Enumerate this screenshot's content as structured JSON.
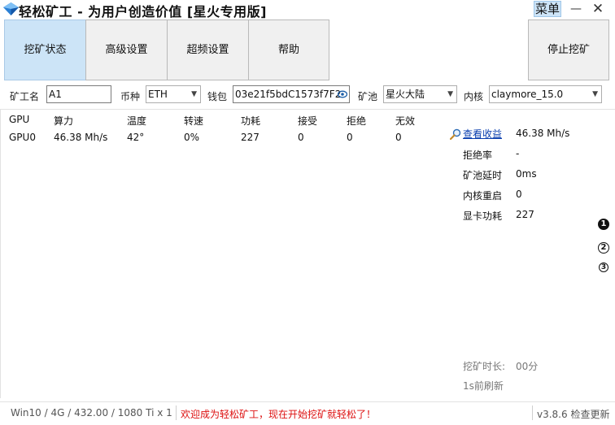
{
  "app": {
    "title": "轻松矿工 - 为用户创造价值 [星火专用版]"
  },
  "titlebar": {
    "menu_label": "菜单",
    "minimize_glyph": "—",
    "close_glyph": "✕"
  },
  "tabs": [
    {
      "label": "挖矿状态",
      "active": true
    },
    {
      "label": "高级设置",
      "active": false
    },
    {
      "label": "超频设置",
      "active": false
    },
    {
      "label": "帮助",
      "active": false
    }
  ],
  "stop_button_label": "停止挖矿",
  "config": {
    "worker_label": "矿工名",
    "worker_value": "A1",
    "coin_label": "币种",
    "coin_value": "ETH",
    "wallet_label": "钱包",
    "wallet_value": "03e21f5bdC1573f7F2",
    "pool_label": "矿池",
    "pool_value": "星火大陆",
    "kernel_label": "内核",
    "kernel_value": "claymore_15.0"
  },
  "table": {
    "headers": [
      "GPU",
      "算力",
      "温度",
      "转速",
      "功耗",
      "接受",
      "拒绝",
      "无效"
    ],
    "rows": [
      [
        "GPU0",
        "46.38 Mh/s",
        "42°",
        "0%",
        "227",
        "0",
        "0",
        "0"
      ]
    ]
  },
  "stats": {
    "link_label": "查看收益",
    "hashrate_value": "46.38 Mh/s",
    "items": [
      {
        "label": "拒绝率",
        "value": "-"
      },
      {
        "label": "矿池延时",
        "value": "0ms"
      },
      {
        "label": "内核重启",
        "value": "0"
      },
      {
        "label": "显卡功耗",
        "value": "227"
      }
    ],
    "runtime_label": "挖矿时长:",
    "runtime_value": "00分",
    "refresh_text": "1s前刷新"
  },
  "page_indicators": [
    "1",
    "2",
    "3"
  ],
  "status_bar": {
    "system_info": "Win10  / 4G / 432.00 / 1080 Ti x 1",
    "message": "欢迎成为轻松矿工，现在开始挖矿就轻松了！",
    "version": "v3.8.6 检查更新"
  },
  "colors": {
    "accent_tab": "#cce4f7",
    "link": "#0a3fae",
    "status_message": "#dd1111"
  }
}
